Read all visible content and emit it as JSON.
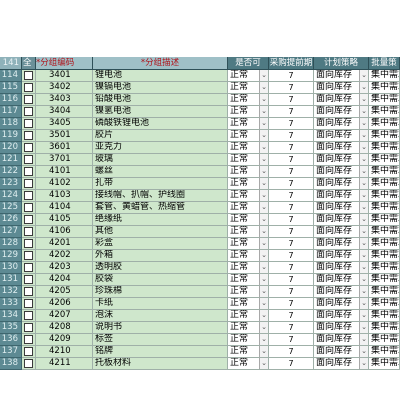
{
  "header": {
    "row_count": "141",
    "select_label": "全",
    "code_label": "分组编码",
    "desc_label": "分组描述",
    "active_label": "是否可",
    "leadtime_label": "采购提前期",
    "strategy_label": "计划策略",
    "pool_label": "批量策"
  },
  "rows": [
    {
      "num": "114",
      "code": "3401",
      "desc": "锂电池",
      "active": "正常",
      "leadtime": "7",
      "strategy": "面向库存",
      "pool": "集中需求"
    },
    {
      "num": "115",
      "code": "3402",
      "desc": "镍镉电池",
      "active": "正常",
      "leadtime": "7",
      "strategy": "面向库存",
      "pool": "集中需求"
    },
    {
      "num": "116",
      "code": "3403",
      "desc": "铅酸电池",
      "active": "正常",
      "leadtime": "7",
      "strategy": "面向库存",
      "pool": "集中需求"
    },
    {
      "num": "117",
      "code": "3404",
      "desc": "镍氢电池",
      "active": "正常",
      "leadtime": "7",
      "strategy": "面向库存",
      "pool": "集中需求"
    },
    {
      "num": "118",
      "code": "3405",
      "desc": "磷酸铁锂电池",
      "active": "正常",
      "leadtime": "7",
      "strategy": "面向库存",
      "pool": "集中需求"
    },
    {
      "num": "119",
      "code": "3501",
      "desc": "胶片",
      "active": "正常",
      "leadtime": "7",
      "strategy": "面向库存",
      "pool": "集中需求"
    },
    {
      "num": "120",
      "code": "3601",
      "desc": "亚克力",
      "active": "正常",
      "leadtime": "7",
      "strategy": "面向库存",
      "pool": "集中需求"
    },
    {
      "num": "121",
      "code": "3701",
      "desc": "玻璃",
      "active": "正常",
      "leadtime": "7",
      "strategy": "面向库存",
      "pool": "集中需求"
    },
    {
      "num": "122",
      "code": "4101",
      "desc": "螺丝",
      "active": "正常",
      "leadtime": "7",
      "strategy": "面向库存",
      "pool": "集中需求"
    },
    {
      "num": "123",
      "code": "4102",
      "desc": "扎带",
      "active": "正常",
      "leadtime": "7",
      "strategy": "面向库存",
      "pool": "集中需求"
    },
    {
      "num": "124",
      "code": "4103",
      "desc": "接线帽、扒帽、护线圈",
      "active": "正常",
      "leadtime": "7",
      "strategy": "面向库存",
      "pool": "集中需求"
    },
    {
      "num": "125",
      "code": "4104",
      "desc": "套管、黄蜡管、热缩管",
      "active": "正常",
      "leadtime": "7",
      "strategy": "面向库存",
      "pool": "集中需求"
    },
    {
      "num": "126",
      "code": "4105",
      "desc": "绝缘纸",
      "active": "正常",
      "leadtime": "7",
      "strategy": "面向库存",
      "pool": "集中需求"
    },
    {
      "num": "127",
      "code": "4106",
      "desc": "其他",
      "active": "正常",
      "leadtime": "7",
      "strategy": "面向库存",
      "pool": "集中需求"
    },
    {
      "num": "128",
      "code": "4201",
      "desc": "彩盒",
      "active": "正常",
      "leadtime": "7",
      "strategy": "面向库存",
      "pool": "集中需求"
    },
    {
      "num": "129",
      "code": "4202",
      "desc": "外箱",
      "active": "正常",
      "leadtime": "7",
      "strategy": "面向库存",
      "pool": "集中需求"
    },
    {
      "num": "130",
      "code": "4203",
      "desc": "透明胶",
      "active": "正常",
      "leadtime": "7",
      "strategy": "面向库存",
      "pool": "集中需求"
    },
    {
      "num": "131",
      "code": "4204",
      "desc": "胶袋",
      "active": "正常",
      "leadtime": "7",
      "strategy": "面向库存",
      "pool": "集中需求"
    },
    {
      "num": "132",
      "code": "4205",
      "desc": "珍珠棉",
      "active": "正常",
      "leadtime": "7",
      "strategy": "面向库存",
      "pool": "集中需求"
    },
    {
      "num": "133",
      "code": "4206",
      "desc": "卡纸",
      "active": "正常",
      "leadtime": "7",
      "strategy": "面向库存",
      "pool": "集中需求"
    },
    {
      "num": "134",
      "code": "4207",
      "desc": "泡沫",
      "active": "正常",
      "leadtime": "7",
      "strategy": "面向库存",
      "pool": "集中需求"
    },
    {
      "num": "135",
      "code": "4208",
      "desc": "说明书",
      "active": "正常",
      "leadtime": "7",
      "strategy": "面向库存",
      "pool": "集中需求"
    },
    {
      "num": "136",
      "code": "4209",
      "desc": "标签",
      "active": "正常",
      "leadtime": "7",
      "strategy": "面向库存",
      "pool": "集中需求"
    },
    {
      "num": "137",
      "code": "4210",
      "desc": "铭牌",
      "active": "正常",
      "leadtime": "7",
      "strategy": "面向库存",
      "pool": "集中需求"
    },
    {
      "num": "138",
      "code": "4211",
      "desc": "托板材料",
      "active": "正常",
      "leadtime": "7",
      "strategy": "面向库存",
      "pool": "集中需求"
    }
  ],
  "icons": {
    "dropdown": "chevron-down-icon"
  },
  "colors": {
    "header_bg": "#4f7a83",
    "row_bg": "#cfe7cc",
    "required_mark": "#b0141c"
  }
}
